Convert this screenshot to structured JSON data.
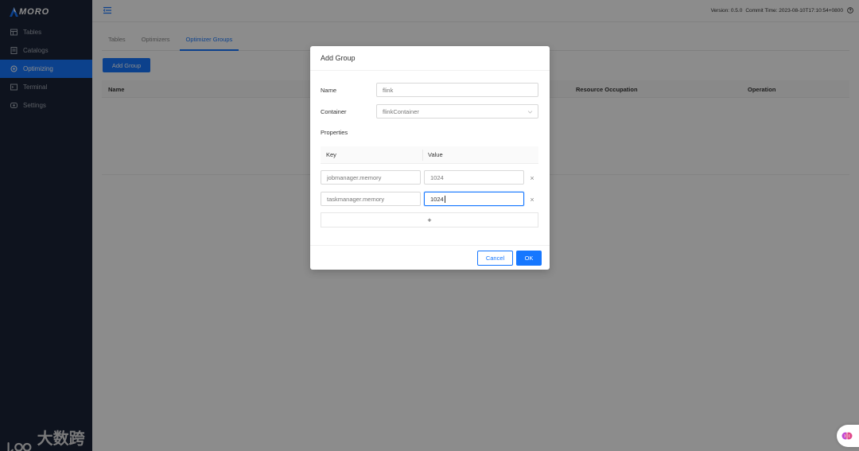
{
  "app": {
    "logo_text": "MORO"
  },
  "sidebar": {
    "items": [
      {
        "label": "Tables",
        "icon": "table-icon"
      },
      {
        "label": "Catalogs",
        "icon": "catalog-icon"
      },
      {
        "label": "Optimizing",
        "icon": "optimizing-icon",
        "active": true
      },
      {
        "label": "Terminal",
        "icon": "terminal-icon"
      },
      {
        "label": "Settings",
        "icon": "settings-icon"
      }
    ]
  },
  "topbar": {
    "version": "Version: 0.5.0",
    "commit_time": "Commit Time: 2023-08-10T17:10:54+0800"
  },
  "tabs": [
    {
      "label": "Tables"
    },
    {
      "label": "Optimizers"
    },
    {
      "label": "Optimizer Groups",
      "active": true
    }
  ],
  "add_group_button": "Add Group",
  "table": {
    "columns": [
      "Name",
      "Resource Occupation",
      "Operation"
    ]
  },
  "modal": {
    "title": "Add Group",
    "name_label": "Name",
    "name_value": "flink",
    "container_label": "Container",
    "container_value": "flinkContainer",
    "properties_label": "Properties",
    "properties_columns": [
      "Key",
      "Value"
    ],
    "properties": [
      {
        "key": "jobmanager.memory",
        "value": "1024"
      },
      {
        "key": "taskmanager.memory",
        "value": "1024"
      }
    ],
    "add_row_label": "+",
    "remove_label": "×",
    "cancel_label": "Cancel",
    "ok_label": "OK"
  },
  "watermark": {
    "text": "大数跨境"
  },
  "colors": {
    "primary": "#1677ff",
    "sidebar_bg": "#1b2337"
  }
}
